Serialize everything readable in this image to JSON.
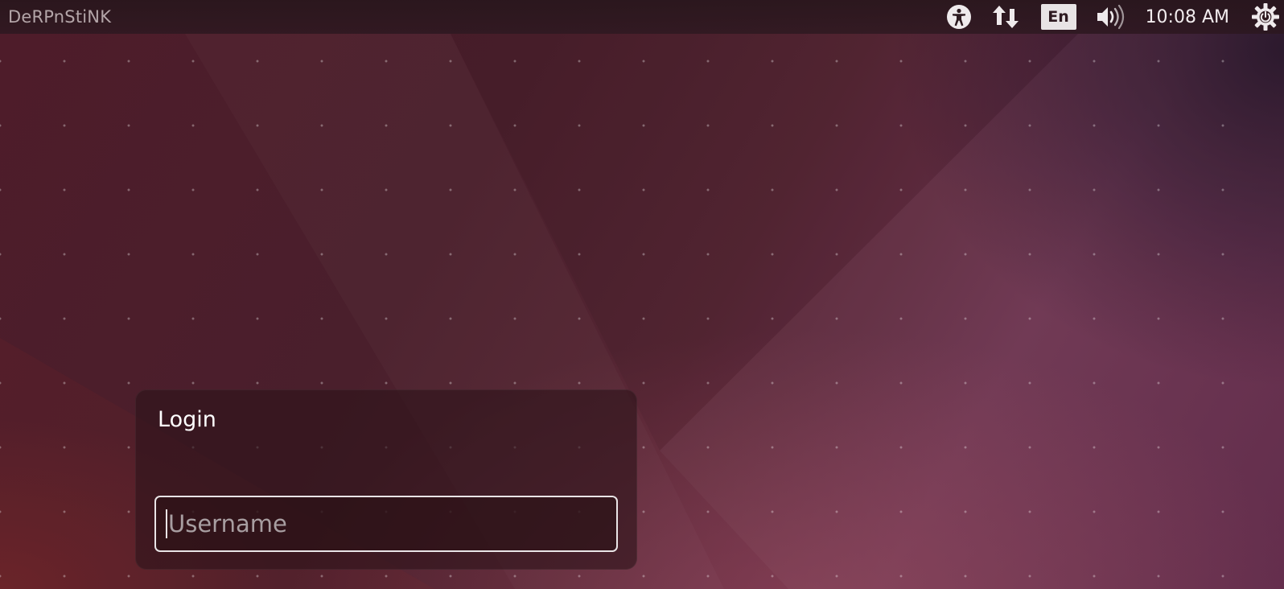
{
  "panel": {
    "hostname": "DeRPnStiNK",
    "keyboard_layout": "En",
    "clock": "10:08 AM",
    "icons": {
      "accessibility": "accessibility-icon",
      "network": "network-updown-icon",
      "sound": "volume-icon",
      "power": "power-gear-icon"
    }
  },
  "login": {
    "title": "Login",
    "username_placeholder": "Username",
    "username_value": ""
  },
  "colors": {
    "panel_bg": "#2b161c",
    "wallpaper_base": "#4e1c2a",
    "wallpaper_accent": "#6d3450",
    "text": "#ffffff"
  }
}
